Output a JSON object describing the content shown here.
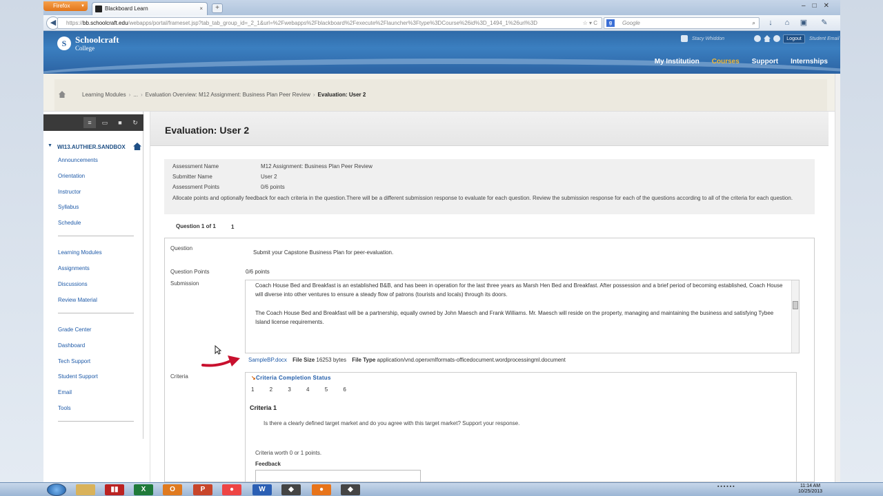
{
  "browser": {
    "app_button": "Firefox",
    "tab_title": "Blackboard Learn",
    "new_tab": "+",
    "url_prefix": "https://",
    "url_host": "bb.schoolcraft.edu",
    "url_rest": "/webapps/portal/frameset.jsp?tab_tab_group_id=_2_1&url=%2Fwebapps%2Fblackboard%2Fexecute%2Flauncher%3Ftype%3DCourse%26id%3D_1494_1%26url%3D",
    "search_placeholder": "Google"
  },
  "header": {
    "logo_name": "Schoolcraft",
    "logo_sub": "College",
    "user_name": "Stacy Whiddon",
    "logout": "Logout",
    "student_email": "Student Email",
    "nav": [
      "My Institution",
      "Courses",
      "Support",
      "Internships"
    ],
    "active_nav": "Courses"
  },
  "breadcrumb": {
    "items": [
      "Learning Modules",
      "...",
      "Evaluation Overview: M12 Assignment: Business Plan Peer Review"
    ],
    "current": "Evaluation: User 2"
  },
  "sidebar": {
    "course": "WI13.AUTHIER.SANDBOX",
    "group1": [
      "Announcements",
      "Orientation",
      "Instructor",
      "Syllabus",
      "Schedule"
    ],
    "group2": [
      "Learning Modules",
      "Assignments",
      "Discussions",
      "Review Material"
    ],
    "group3": [
      "Grade Center",
      "Dashboard",
      "Tech Support",
      "Student Support",
      "Email",
      "Tools"
    ]
  },
  "page": {
    "title": "Evaluation: User 2"
  },
  "meta": {
    "assessment_name_label": "Assessment Name",
    "assessment_name": "M12 Assignment: Business Plan Peer Review",
    "submitter_label": "Submitter Name",
    "submitter": "User 2",
    "points_label": "Assessment Points",
    "points": "0/6 points",
    "instructions": "Allocate points and optionally feedback for each criteria in the question.There will be a different submission response to evaluate for each question. Review the submission response for each of the questions according to all of the criteria for each question."
  },
  "question": {
    "tab_label": "Question 1 of 1",
    "tab_num": "1",
    "question_label": "Question",
    "question_text": "Submit your Capstone Business Plan for peer-evaluation.",
    "qpoints_label": "Question Points",
    "qpoints": "0/6 points",
    "submission_label": "Submission",
    "submission_p1": "Coach House Bed and Breakfast is an established B&B, and has been in operation for the last three years as Marsh Hen Bed and Breakfast. After possession and a brief period of becoming established, Coach House will diverse into other ventures to ensure a steady flow of patrons (tourists and locals) through its doors.",
    "submission_p2": "The Coach House Bed and Breakfast will be a partnership, equally owned by John Maesch and Frank Williams. Mr. Maesch will reside on the property, managing and maintaining the business and satisfying Tybee Island license requirements.",
    "file_name": "SampleBP.docx",
    "file_size_label": "File Size",
    "file_size": "16253 bytes",
    "file_type_label": "File Type",
    "file_type": "application/vnd.openxmlformats-officedocument.wordprocessingml.document",
    "criteria_label": "Criteria"
  },
  "criteria": {
    "status_title": "Criteria Completion Status",
    "numbers": "1 2 3 4 5 6",
    "title": "Criteria 1",
    "question": "Is there a clearly defined target market and do you agree with this target market? Support your response.",
    "worth": "Criteria worth 0 or 1 points.",
    "feedback_label": "Feedback"
  },
  "taskbar": {
    "time": "11:14 AM",
    "date": "10/25/2013"
  },
  "colors": {
    "header_blue": "#2f6aa8",
    "active_nav": "#f3b935",
    "link": "#1e5aa8",
    "arrow": "#c8102e"
  }
}
